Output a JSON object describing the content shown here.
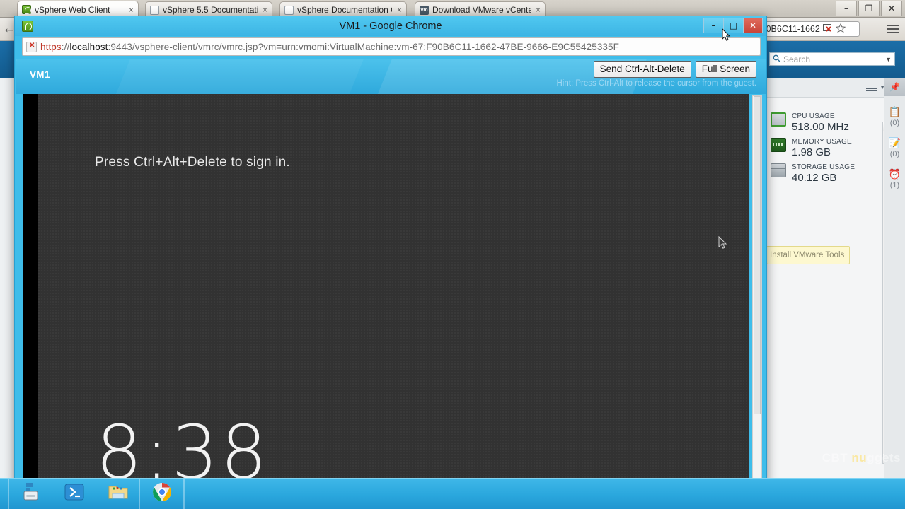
{
  "background_browser": {
    "tabs": [
      {
        "title": "vSphere Web Client",
        "close": "×",
        "favicon": "vsphere-icon",
        "active": true
      },
      {
        "title": "vSphere 5.5 Documentatic",
        "close": "×",
        "favicon": "document-icon",
        "active": false
      },
      {
        "title": "vSphere Documentation C",
        "close": "×",
        "favicon": "document-icon",
        "active": false
      },
      {
        "title": "Download VMware vCente",
        "close": "×",
        "favicon": "vmware-icon",
        "active": false
      }
    ],
    "window_controls": {
      "minimize": "–",
      "maximize": "❐",
      "close": "✕"
    },
    "back_arrow": "←",
    "url_fragment": "F90B6C11-1662",
    "bookmark_icon": "star-icon",
    "menu_icon": "hamburger-icon"
  },
  "vsphere": {
    "search_placeholder": "Search",
    "search_icon": "magnifier-icon",
    "metrics": [
      {
        "label": "CPU USAGE",
        "value": "518.00 MHz",
        "icon": "cpu-icon"
      },
      {
        "label": "MEMORY USAGE",
        "value": "1.98 GB",
        "icon": "memory-icon"
      },
      {
        "label": "STORAGE USAGE",
        "value": "40.12 GB",
        "icon": "storage-icon"
      }
    ],
    "rail": {
      "pin_icon": "pin-icon",
      "items": [
        {
          "icon": "tasks-icon",
          "count": "(0)"
        },
        {
          "icon": "notes-icon",
          "count": "(0)"
        },
        {
          "icon": "alarms-icon",
          "count": "(1)"
        }
      ]
    },
    "install_tools_label": "Install VMware Tools",
    "scroll_up": "▲",
    "scroll_down": "▼"
  },
  "chrome_window": {
    "title": "VM1 - Google Chrome",
    "app_icon": "vsphere-icon",
    "controls": {
      "minimize": "–",
      "maximize": "□",
      "close": "✕"
    },
    "omnibox": {
      "security_icon": "insecure-https-icon",
      "scheme": "https",
      "separator": "://",
      "host": "localhost",
      "rest": ":9443/vsphere-client/vmrc/vmrc.jsp?vm=urn:vmomi:VirtualMachine:vm-67:F90B6C11-1662-47BE-9666-E9C55425335F"
    }
  },
  "vmrc": {
    "vm_name": "VM1",
    "buttons": {
      "send_cad": "Send Ctrl-Alt-Delete",
      "full_screen": "Full Screen"
    },
    "hint": "Hint: Press Ctrl-Alt to release the cursor from the guest."
  },
  "guest_console": {
    "sign_in_message": "Press Ctrl+Alt+Delete to sign in.",
    "clock": "8:38"
  },
  "taskbar": {
    "items": [
      {
        "icon": "server-manager-icon"
      },
      {
        "icon": "powershell-icon"
      },
      {
        "icon": "file-explorer-icon"
      },
      {
        "icon": "chrome-icon"
      }
    ]
  },
  "watermark": {
    "prefix": "CBT ",
    "highlight": "nu",
    "suffix": "ggets"
  },
  "colors": {
    "vmrc_blue": "#3fbdea",
    "vsphere_blue": "#1b6ea8",
    "close_red": "#c8453a",
    "console_bg": "#323232"
  }
}
